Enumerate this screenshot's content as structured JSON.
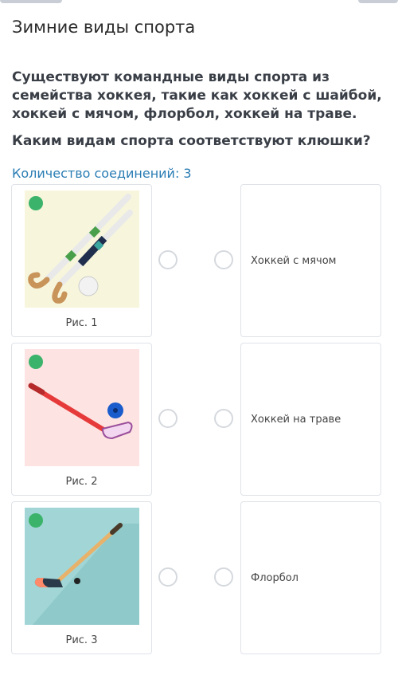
{
  "header": {
    "title": "Зимние виды спорта"
  },
  "question": {
    "text": "Существуют командные виды спорта из семейства хоккея, такие как хоккей с шайбой, хоккей с мячом, флорбол, хоккей на траве.",
    "prompt": "Каким видам спорта соответствуют клюшки?",
    "connections": "Количество соединений: 3"
  },
  "pictures": [
    {
      "caption": "Рис. 1",
      "icon": "field-hockey-sticks-image",
      "bg": "#f7f6dc"
    },
    {
      "caption": "Рис. 2",
      "icon": "floorball-stick-image",
      "bg": "#fde4e2"
    },
    {
      "caption": "Рис. 3",
      "icon": "ice-hockey-stick-image",
      "bg": "#a2d6d6"
    }
  ],
  "options": [
    {
      "label": "Хоккей с мячом"
    },
    {
      "label": "Хоккей на траве"
    },
    {
      "label": "Флорбол"
    }
  ],
  "colors": {
    "accent": "#2a7db4",
    "badge": "#3bb36a",
    "border": "#dfe3e8"
  }
}
